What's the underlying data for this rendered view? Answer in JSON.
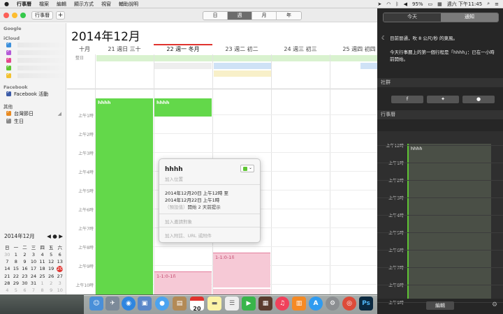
{
  "menubar": {
    "apple": "",
    "app_name": "行事曆",
    "items": [
      "檔案",
      "編輯",
      "顯示方式",
      "視窗",
      "輔助說明"
    ],
    "battery": "95%",
    "clock": "週六 下午11:45"
  },
  "toolbar": {
    "calendars_button": "行事曆",
    "add_button": "+",
    "view_tabs": [
      "日",
      "週",
      "月",
      "年"
    ],
    "active_view": "週"
  },
  "sidebar": {
    "google_header": "Google",
    "icloud_header": "iCloud",
    "facebook_header": "Facebook",
    "facebook_item": "Facebook 活動",
    "other_header": "其他",
    "other_items": [
      "台灣節日",
      "生日"
    ],
    "mini_calendar": {
      "title": "2014年12月",
      "weekdays": [
        "日",
        "一",
        "二",
        "三",
        "四",
        "五",
        "六"
      ],
      "rows": [
        [
          "30",
          "1",
          "2",
          "3",
          "4",
          "5",
          "6"
        ],
        [
          "7",
          "8",
          "9",
          "10",
          "11",
          "12",
          "13"
        ],
        [
          "14",
          "15",
          "16",
          "17",
          "18",
          "19",
          "20"
        ],
        [
          "21",
          "22",
          "23",
          "24",
          "25",
          "26",
          "27"
        ],
        [
          "28",
          "29",
          "30",
          "31",
          "1",
          "2",
          "3"
        ],
        [
          "4",
          "5",
          "6",
          "7",
          "8",
          "9",
          "10"
        ]
      ],
      "today": "20"
    }
  },
  "week": {
    "month_title": "2014年12月",
    "lunar_month": "十月",
    "days": [
      {
        "label": "21 週日",
        "lunar": "三十"
      },
      {
        "label": "22 週一",
        "lunar": "冬月"
      },
      {
        "label": "23 週二",
        "lunar": "初二"
      },
      {
        "label": "24 週三",
        "lunar": "初三"
      },
      {
        "label": "25 週四",
        "lunar": "初四"
      }
    ],
    "allday_label": "整日",
    "hours": [
      "上午1時",
      "上午2時",
      "上午3時",
      "上午4時",
      "上午5時",
      "上午6時",
      "上午7時",
      "上午8時",
      "上午9時",
      "上午10時"
    ],
    "events": [
      {
        "title": "hhhh",
        "day": 0
      },
      {
        "title": "hhhh",
        "day": 1
      }
    ],
    "pink_event_1": "1-1:0-1ñ",
    "pink_event_2": "1-1:0-1ñ"
  },
  "popover": {
    "title": "hhhh",
    "location_placeholder": "加入位置",
    "start": "2014年12月20日  上午12時 至",
    "end": "2014年12月22日  上午1時",
    "alert_default": "（預設值）",
    "alert": "開始 2 天前提示",
    "invitees_placeholder": "加入邀請對象",
    "notes_placeholder": "加入附註、URL 或附件"
  },
  "notification_center": {
    "tabs": [
      "今天",
      "通知"
    ],
    "active_tab": "通知",
    "weather": "目前晉通，吹 8 公尺/秒 的東風。",
    "next_event": "今天行事曆上的第一個行程是「hhhh」：已在一小時前開始。",
    "social_header": "社群",
    "calendar_header": "行事曆",
    "hours": [
      "上午12時",
      "上午1時",
      "上午2時",
      "上午3時",
      "上午4時",
      "上午5時",
      "上午6時",
      "上午7時",
      "上午8時",
      "上午9時"
    ],
    "event_title": "hhhh",
    "edit_button": "編輯"
  },
  "dock": {
    "calendar_icon_date": "20"
  },
  "colors": {
    "event_green": "#5fc534",
    "event_pink": "#f6c9d6",
    "today_red": "#e0332e"
  }
}
